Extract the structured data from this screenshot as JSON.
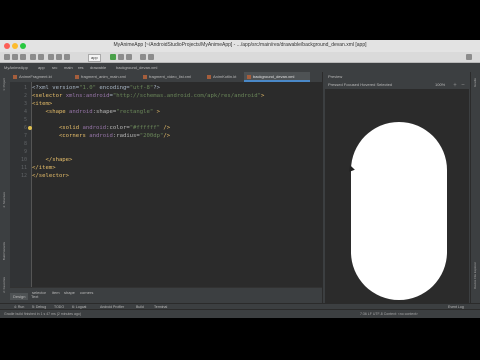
{
  "window": {
    "title": "MyAnimeApp [~/AndroidStudioProjects/MyAnimeApp] - .../app/src/main/res/drawable/background_devan.xml [app]"
  },
  "toolbar": {
    "config_label": "app"
  },
  "navbar": {
    "crumbs": [
      "MyAnimeApp",
      "app",
      "src",
      "main",
      "res",
      "drawable",
      "background_devan.xml"
    ]
  },
  "tabs": [
    {
      "label": "AnimeFragment.kt",
      "active": false
    },
    {
      "label": "fragment_anim_main.xml",
      "active": false
    },
    {
      "label": "fragment_video_list.xml",
      "active": false
    },
    {
      "label": "AnimKotlin.kt",
      "active": false
    },
    {
      "label": "background_devan.xml",
      "active": true
    }
  ],
  "left_tool_tabs": [
    "1: Project",
    "2: Structure",
    "Build Variants",
    "2: Favorites"
  ],
  "code": {
    "lines": [
      {
        "n": "1",
        "parts": [
          {
            "c": "plain",
            "t": "<?xml version="
          },
          {
            "c": "val",
            "t": "\"1.0\""
          },
          {
            "c": "plain",
            "t": " encoding="
          },
          {
            "c": "val",
            "t": "\"utf-8\""
          },
          {
            "c": "plain",
            "t": "?>"
          }
        ]
      },
      {
        "n": "2",
        "parts": [
          {
            "c": "tag",
            "t": "<selector "
          },
          {
            "c": "ns",
            "t": "xmlns:android"
          },
          {
            "c": "plain",
            "t": "="
          },
          {
            "c": "val",
            "t": "\"http://schemas.android.com/apk/res/android\""
          },
          {
            "c": "tag",
            "t": ">"
          }
        ]
      },
      {
        "n": "3",
        "parts": [
          {
            "c": "tag",
            "t": "<item>"
          }
        ]
      },
      {
        "n": "4",
        "parts": [
          {
            "c": "tag",
            "t": "    <shape "
          },
          {
            "c": "ns",
            "t": "android"
          },
          {
            "c": "attr",
            "t": ":shape="
          },
          {
            "c": "val",
            "t": "\"rectangle\""
          },
          {
            "c": "tag",
            "t": " >"
          }
        ]
      },
      {
        "n": "5",
        "parts": [
          {
            "c": "plain",
            "t": ""
          }
        ]
      },
      {
        "n": "6",
        "parts": [
          {
            "c": "tag",
            "t": "        <solid "
          },
          {
            "c": "ns",
            "t": "android"
          },
          {
            "c": "attr",
            "t": ":color="
          },
          {
            "c": "val",
            "t": "\"#ffffff\""
          },
          {
            "c": "tag",
            "t": " />"
          }
        ]
      },
      {
        "n": "7",
        "parts": [
          {
            "c": "tag",
            "t": "        <corners "
          },
          {
            "c": "ns",
            "t": "android"
          },
          {
            "c": "attr",
            "t": ":radius="
          },
          {
            "c": "val",
            "t": "\"200dp\""
          },
          {
            "c": "tag",
            "t": "/>"
          }
        ]
      },
      {
        "n": "8",
        "parts": [
          {
            "c": "plain",
            "t": ""
          }
        ]
      },
      {
        "n": "9",
        "parts": [
          {
            "c": "plain",
            "t": ""
          }
        ]
      },
      {
        "n": "10",
        "parts": [
          {
            "c": "tag",
            "t": "    </shape>"
          }
        ]
      },
      {
        "n": "11",
        "parts": [
          {
            "c": "tag",
            "t": "</item>"
          }
        ]
      },
      {
        "n": "12",
        "parts": [
          {
            "c": "tag",
            "t": "</selector>"
          }
        ]
      }
    ]
  },
  "editor_breadcrumb": [
    "selector",
    "item",
    "shape",
    "corners"
  ],
  "design_tabs": {
    "design": "Design",
    "text": "Text"
  },
  "preview": {
    "title": "Preview",
    "states": "Pressed  Focused  Hovered  Selected",
    "zoom": "100%"
  },
  "tool_windows": [
    "4: Run",
    "5: Debug",
    "TODO",
    "6: Logcat",
    "Android Profiler",
    "Build",
    "Terminal",
    "Event Log"
  ],
  "status": {
    "message": "Gradle build finished in 1 s 47 ms (2 minutes ago)",
    "right": "7:36  LF  UTF-8  Context: <no context>"
  }
}
